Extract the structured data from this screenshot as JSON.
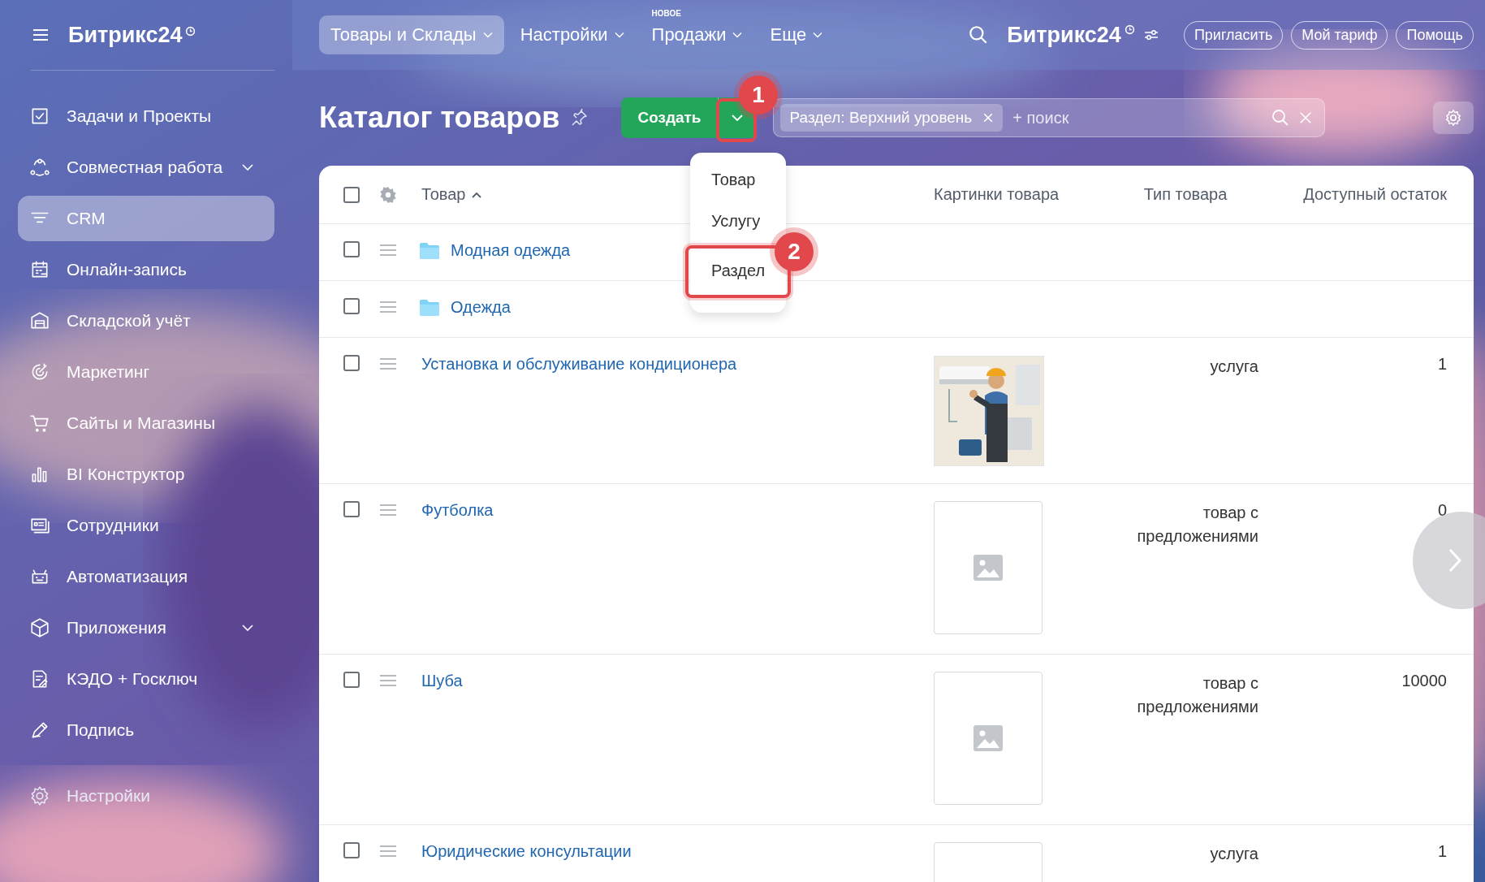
{
  "sidebar": {
    "logo": "Битрикс24",
    "items": [
      {
        "label": "Задачи и Проекты",
        "selected": false,
        "has_submenu": false
      },
      {
        "label": "Совместная работа",
        "selected": false,
        "has_submenu": true
      },
      {
        "label": "CRM",
        "selected": true,
        "has_submenu": false
      },
      {
        "label": "Онлайн-запись",
        "selected": false,
        "has_submenu": false
      },
      {
        "label": "Складской учёт",
        "selected": false,
        "has_submenu": false
      },
      {
        "label": "Маркетинг",
        "selected": false,
        "has_submenu": false
      },
      {
        "label": "Сайты и Магазины",
        "selected": false,
        "has_submenu": false
      },
      {
        "label": "BI Конструктор",
        "selected": false,
        "has_submenu": false
      },
      {
        "label": "Сотрудники",
        "selected": false,
        "has_submenu": false
      },
      {
        "label": "Автоматизация",
        "selected": false,
        "has_submenu": false
      },
      {
        "label": "Приложения",
        "selected": false,
        "has_submenu": true
      },
      {
        "label": "КЭДО + Госключ",
        "selected": false,
        "has_submenu": false
      },
      {
        "label": "Подпись",
        "selected": false,
        "has_submenu": false
      }
    ],
    "settings": "Настройки"
  },
  "topbar": {
    "menu": [
      {
        "label": "Товары и Склады",
        "selected": true
      },
      {
        "label": "Настройки",
        "selected": false
      },
      {
        "label": "Продажи",
        "selected": false,
        "badge": "НОВОЕ"
      },
      {
        "label": "Еще",
        "selected": false
      }
    ],
    "brand": "Битрикс24",
    "buttons": [
      "Пригласить",
      "Мой тариф",
      "Помощь"
    ]
  },
  "page": {
    "title": "Каталог товаров",
    "create_button": "Создать",
    "filter_tag": "Раздел: Верхний уровень",
    "search_placeholder": "+ поиск"
  },
  "create_menu": {
    "items": [
      {
        "label": "Товар",
        "highlighted": false
      },
      {
        "label": "Услугу",
        "highlighted": false
      },
      {
        "label": "Раздел",
        "highlighted": true
      }
    ]
  },
  "annotations": [
    "1",
    "2"
  ],
  "table": {
    "columns": [
      "Товар",
      "Картинки товара",
      "Тип товара",
      "Доступный остаток"
    ],
    "all_checked": false,
    "rows": [
      {
        "kind": "folder",
        "name": "Модная одежда",
        "checked": false
      },
      {
        "kind": "folder",
        "name": "Одежда",
        "checked": false
      },
      {
        "name": "Установка и обслуживание кондиционера",
        "checked": false,
        "type": "услуга",
        "stock": "1"
      },
      {
        "kind": "noimage",
        "name": "Футболка",
        "checked": false,
        "type": "товар с предложениями",
        "stock": "0"
      },
      {
        "kind": "noimage",
        "name": "Шуба",
        "checked": false,
        "type": "товар с предложениями",
        "stock": "10000"
      },
      {
        "kind": "noimage",
        "name": "Юридические консультации",
        "checked": false,
        "type": "услуга",
        "stock": "1"
      }
    ]
  }
}
